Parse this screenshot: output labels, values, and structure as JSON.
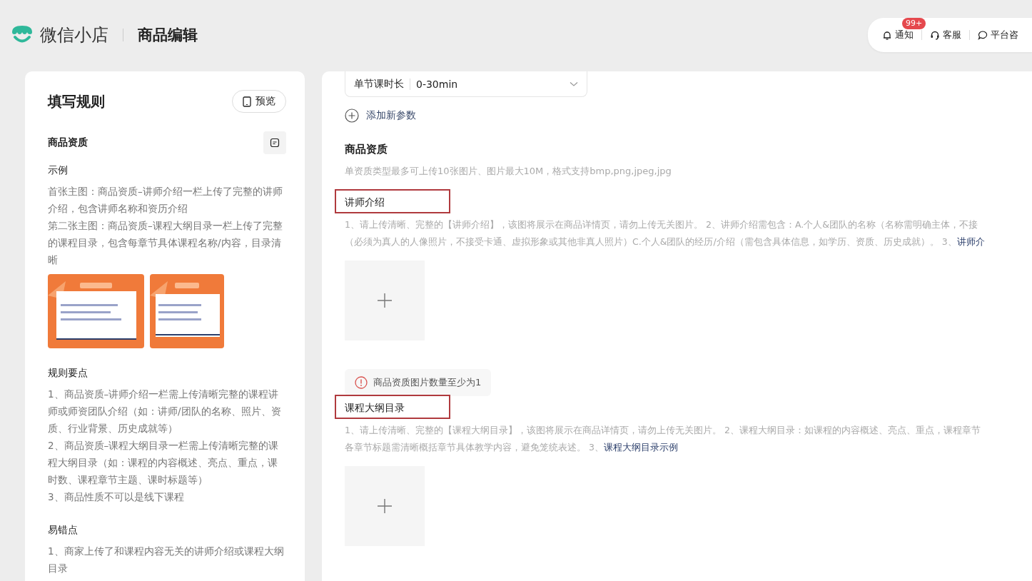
{
  "header": {
    "app_name": "微信小店",
    "page_title": "商品编辑",
    "actions": [
      {
        "kind": "bell",
        "label": "通知",
        "badge": "99+"
      },
      {
        "kind": "headset",
        "label": "客服"
      },
      {
        "kind": "chat",
        "label": "平台咨"
      }
    ]
  },
  "rules_panel": {
    "title": "填写规则",
    "preview_button": "预览",
    "section_title": "商品资质",
    "example_heading": "示例",
    "example_lines": [
      "首张主图：商品资质–讲师介绍一栏上传了完整的讲师介绍，包含讲师名称和资历介绍",
      "第二张主图：商品资质–课程大纲目录一栏上传了完整的课程目录，包含每章节具体课程名称/内容，目录清晰"
    ],
    "example_images": [
      {
        "kind": "picture"
      },
      {
        "kind": "picture"
      }
    ],
    "key_points_heading": "规则要点",
    "key_points": [
      "1、商品资质–讲师介绍一栏需上传清晰完整的课程讲师或师资团队介绍（如：讲师/团队的名称、照片、资质、行业背景、历史成就等）",
      "2、商品资质–课程大纲目录一栏需上传清晰完整的课程大纲目录（如：课程的内容概述、亮点、重点，课时数、课程章节主题、课时标题等）",
      "3、商品性质不可以是线下课程"
    ],
    "mistakes_heading": "易错点",
    "mistakes": [
      "1、商家上传了和课程内容无关的讲师介绍或课程大纲目录"
    ]
  },
  "form": {
    "param_field": {
      "label": "单节课时长",
      "value": "0-30min"
    },
    "add_param": "添加新参数",
    "section_title": "商品资质",
    "section_hint": "单资质类型最多可上传10张图片、图片最大10M，格式支持bmp,png,jpeg,jpg",
    "qualifications": [
      {
        "title": "讲师介绍",
        "annotated": true,
        "lines": [
          "1、请上传清晰、完整的【讲师介绍】，该图将展示在商品详情页，请勿上传无关图片。 2、讲师介绍需包含：A.个人&团队的名称（名称需明确主体，不接",
          "（必须为真人的人像照片，不接受卡通、虚拟形象或其他非真人照片）C.个人&团队的经历/介绍（需包含具体信息，如学历、资质、历史成就）。 3、"
        ],
        "link": "讲师介",
        "error": "商品资质图片数量至少为1"
      },
      {
        "title": "课程大纲目录",
        "annotated": true,
        "lines": [
          "1、请上传清晰、完整的【课程大纲目录】，该图将展示在商品详情页，请勿上传无关图片。 2、课程大纲目录：如课程的内容概述、亮点、重点，课程章节",
          "各章节标题需清晰概括章节具体教学内容，避免笼统表述。 3、"
        ],
        "link": "课程大纲目录示例"
      }
    ]
  }
}
